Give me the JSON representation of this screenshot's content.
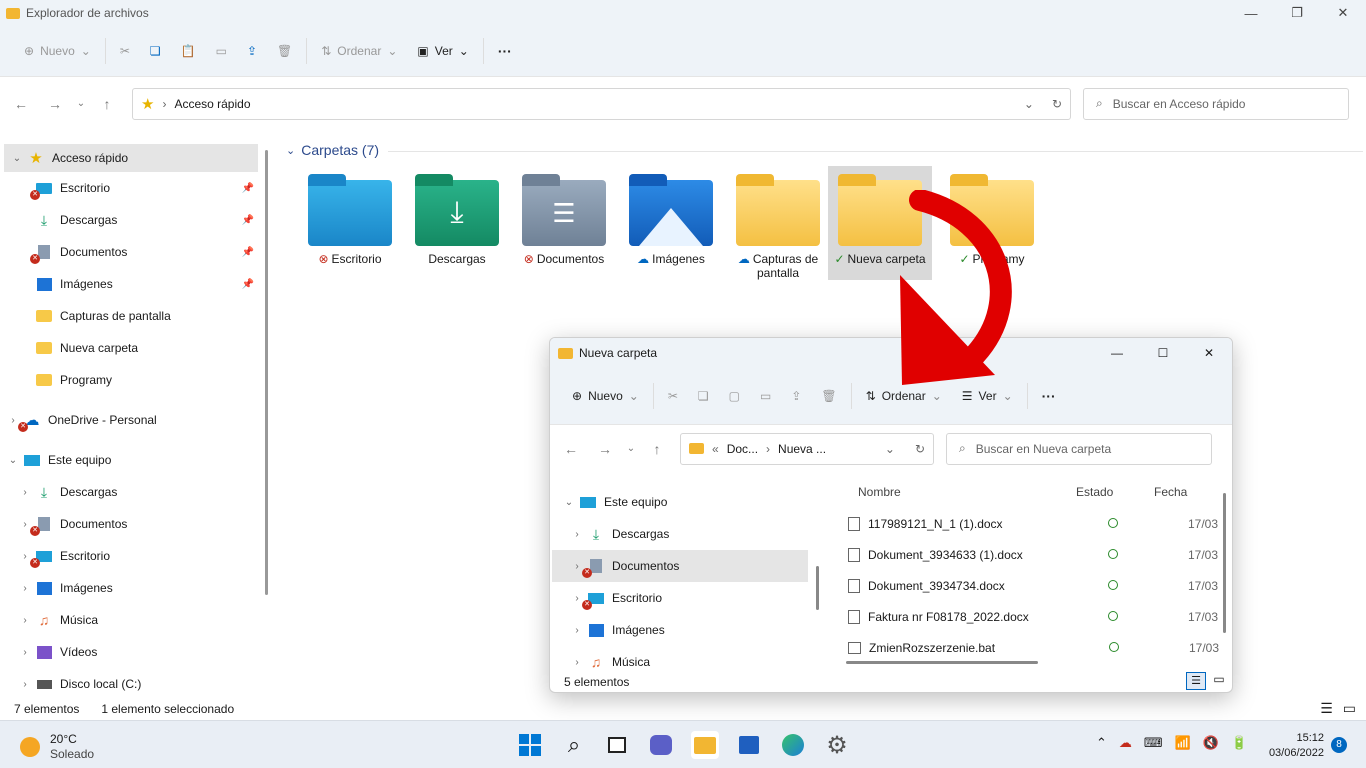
{
  "window": {
    "title": "Explorador de archivos"
  },
  "toolbar": {
    "nuevo": "Nuevo",
    "ordenar": "Ordenar",
    "ver": "Ver",
    "more": "···"
  },
  "address": {
    "path": "Acceso rápido",
    "search_placeholder": "Buscar en Acceso rápido"
  },
  "sidebar": {
    "items": [
      {
        "label": "Acceso rápido"
      },
      {
        "label": "Escritorio"
      },
      {
        "label": "Descargas"
      },
      {
        "label": "Documentos"
      },
      {
        "label": "Imágenes"
      },
      {
        "label": "Capturas de pantalla"
      },
      {
        "label": "Nueva carpeta"
      },
      {
        "label": "Programy"
      },
      {
        "label": "OneDrive - Personal"
      },
      {
        "label": "Este equipo"
      },
      {
        "label": "Descargas"
      },
      {
        "label": "Documentos"
      },
      {
        "label": "Escritorio"
      },
      {
        "label": "Imágenes"
      },
      {
        "label": "Música"
      },
      {
        "label": "Vídeos"
      },
      {
        "label": "Disco local (C:)"
      }
    ]
  },
  "section": {
    "title": "Carpetas (7)"
  },
  "folders": [
    {
      "label": "Escritorio"
    },
    {
      "label": "Descargas"
    },
    {
      "label": "Documentos"
    },
    {
      "label": "Imágenes"
    },
    {
      "label_line1": "Capturas de",
      "label_line2": "pantalla"
    },
    {
      "label": "Nueva carpeta"
    },
    {
      "label": "Programy"
    }
  ],
  "status": {
    "count": "7 elementos",
    "selected": "1 elemento seleccionado"
  },
  "taskbar": {
    "temp": "20°C",
    "weather": "Soleado",
    "time": "15:12",
    "date": "03/06/2022",
    "badge": "8"
  },
  "popup": {
    "title": "Nueva carpeta",
    "toolbar": {
      "nuevo": "Nuevo",
      "ordenar": "Ordenar",
      "ver": "Ver",
      "more": "···"
    },
    "address": {
      "seg1": "Doc...",
      "seg2": "Nueva ...",
      "search_placeholder": "Buscar en Nueva carpeta"
    },
    "nav": [
      {
        "label": "Este equipo"
      },
      {
        "label": "Descargas"
      },
      {
        "label": "Documentos"
      },
      {
        "label": "Escritorio"
      },
      {
        "label": "Imágenes"
      },
      {
        "label": "Música"
      }
    ],
    "columns": {
      "name": "Nombre",
      "status": "Estado",
      "date": "Fecha"
    },
    "files": [
      {
        "name": "117989121_N_1 (1).docx",
        "date": "17/03"
      },
      {
        "name": "Dokument_3934633 (1).docx",
        "date": "17/03"
      },
      {
        "name": "Dokument_3934734.docx",
        "date": "17/03"
      },
      {
        "name": "Faktura nr F08178_2022.docx",
        "date": "17/03"
      },
      {
        "name": "ZmienRozszerzenie.bat",
        "date": "17/03"
      }
    ],
    "status": "5 elementos"
  },
  "colors": {
    "accent": "#0067c0",
    "folder_yellow": "#f7c948",
    "error": "#c42b1c",
    "ok": "#2a8a2a",
    "arrow": "#e00000"
  }
}
